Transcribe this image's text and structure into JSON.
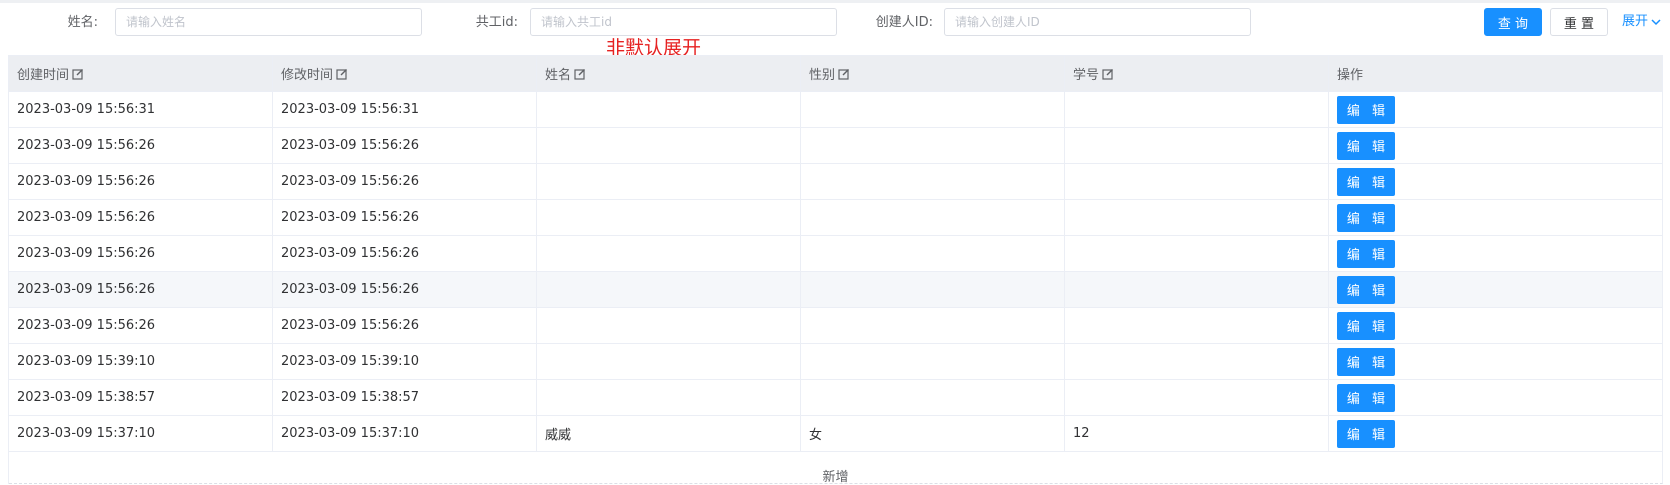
{
  "search": {
    "name_label": "姓名:",
    "name_placeholder": "请输入姓名",
    "employee_label": "共工id:",
    "employee_placeholder": "请输入共工id",
    "creator_label": "创建人ID:",
    "creator_placeholder": "请输入创建人ID",
    "query_label": "查 询",
    "reset_label": "重 置",
    "expand_label": "展开"
  },
  "note": "非默认展开",
  "table": {
    "headers": [
      "创建时间",
      "修改时间",
      "姓名",
      "性别",
      "学号",
      "操作"
    ],
    "edit_label": "编 辑",
    "rows": [
      {
        "created": "2023-03-09 15:56:31",
        "modified": "2023-03-09 15:56:31",
        "name": "",
        "gender": "",
        "student_no": ""
      },
      {
        "created": "2023-03-09 15:56:26",
        "modified": "2023-03-09 15:56:26",
        "name": "",
        "gender": "",
        "student_no": ""
      },
      {
        "created": "2023-03-09 15:56:26",
        "modified": "2023-03-09 15:56:26",
        "name": "",
        "gender": "",
        "student_no": ""
      },
      {
        "created": "2023-03-09 15:56:26",
        "modified": "2023-03-09 15:56:26",
        "name": "",
        "gender": "",
        "student_no": ""
      },
      {
        "created": "2023-03-09 15:56:26",
        "modified": "2023-03-09 15:56:26",
        "name": "",
        "gender": "",
        "student_no": ""
      },
      {
        "created": "2023-03-09 15:56:26",
        "modified": "2023-03-09 15:56:26",
        "name": "",
        "gender": "",
        "student_no": ""
      },
      {
        "created": "2023-03-09 15:56:26",
        "modified": "2023-03-09 15:56:26",
        "name": "",
        "gender": "",
        "student_no": ""
      },
      {
        "created": "2023-03-09 15:39:10",
        "modified": "2023-03-09 15:39:10",
        "name": "",
        "gender": "",
        "student_no": ""
      },
      {
        "created": "2023-03-09 15:38:57",
        "modified": "2023-03-09 15:38:57",
        "name": "",
        "gender": "",
        "student_no": ""
      },
      {
        "created": "2023-03-09 15:37:10",
        "modified": "2023-03-09 15:37:10",
        "name": "威威",
        "gender": "女",
        "student_no": "12"
      }
    ],
    "add_label": "新增"
  },
  "colors": {
    "primary": "#1890ff",
    "note": "#e62222",
    "header_bg": "#eceef2"
  },
  "icons": {
    "edit_header": "edit-square-icon",
    "expand": "chevron-down-icon"
  }
}
